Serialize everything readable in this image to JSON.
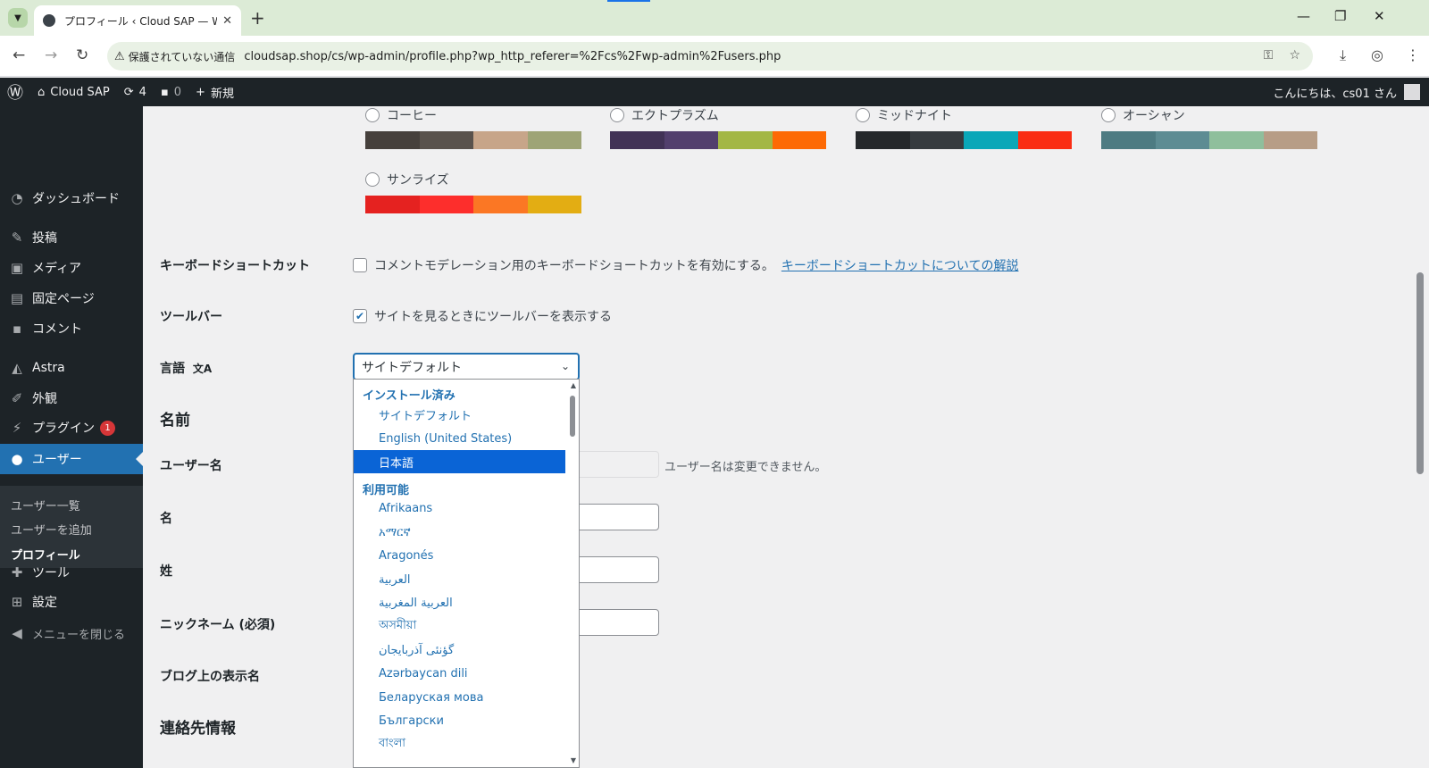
{
  "browser": {
    "tab_title": "プロフィール ‹ Cloud SAP — WordPress",
    "security_label": "保護されていない通信",
    "url": "cloudsap.shop/cs/wp-admin/profile.php?wp_http_referer=%2Fcs%2Fwp-admin%2Fusers.php"
  },
  "adminbar": {
    "site_name": "Cloud SAP",
    "updates_count": "4",
    "comments_count": "0",
    "new_label": "新規",
    "greeting": "こんにちは、cs01 さん"
  },
  "sidebar": {
    "items": [
      {
        "label": "ダッシュボード",
        "icon": "dashboard-icon"
      },
      {
        "label": "投稿",
        "icon": "pin-icon"
      },
      {
        "label": "メディア",
        "icon": "media-icon"
      },
      {
        "label": "固定ページ",
        "icon": "page-icon"
      },
      {
        "label": "コメント",
        "icon": "comment-icon"
      },
      {
        "label": "Astra",
        "icon": "astra-icon"
      },
      {
        "label": "外観",
        "icon": "brush-icon"
      },
      {
        "label": "プラグイン",
        "icon": "plugin-icon",
        "badge": "1"
      },
      {
        "label": "ユーザー",
        "icon": "user-icon"
      },
      {
        "label": "ツール",
        "icon": "wrench-icon"
      },
      {
        "label": "設定",
        "icon": "settings-icon"
      }
    ],
    "submenu": [
      "ユーザー一覧",
      "ユーザーを追加",
      "プロフィール"
    ],
    "collapse_label": "メニューを閉じる"
  },
  "color_schemes": [
    {
      "name": "コーヒー",
      "colors": [
        "#46403c",
        "#59524c",
        "#c7a589",
        "#9ea476"
      ]
    },
    {
      "name": "エクトプラズム",
      "colors": [
        "#413256",
        "#523f6d",
        "#a3b745",
        "#d46f15"
      ]
    },
    {
      "name": "ミッドナイト",
      "colors": [
        "#25282b",
        "#363b3f",
        "#69a8bb",
        "#e14d43"
      ]
    },
    {
      "name": "オーシャン",
      "colors": [
        "#627c83",
        "#738e96",
        "#9ebaa0",
        "#aa9d88"
      ]
    },
    {
      "name": "サンライズ",
      "colors": [
        "#b43c38",
        "#cf4944",
        "#dd823b",
        "#ccaf0b"
      ]
    }
  ],
  "form": {
    "shortcut_label": "キーボードショートカット",
    "shortcut_text": "コメントモデレーション用のキーボードショートカットを有効にする。",
    "shortcut_link": "キーボードショートカットについての解説",
    "toolbar_label": "ツールバー",
    "toolbar_text": "サイトを見るときにツールバーを表示する",
    "toolbar_checked": true,
    "language_label": "言語",
    "language_value": "サイトデフォルト",
    "name_section": "名前",
    "username_label": "ユーザー名",
    "username_desc": "ユーザー名は変更できません。",
    "first_name_label": "名",
    "last_name_label": "姓",
    "nickname_label": "ニックネーム (必須)",
    "display_name_label": "ブログ上の表示名",
    "contact_section": "連絡先情報"
  },
  "language_dropdown": {
    "installed_group": "インストール済み",
    "installed": [
      "サイトデフォルト",
      "English (United States)",
      "日本語"
    ],
    "selected": "日本語",
    "available_group": "利用可能",
    "available": [
      "Afrikaans",
      "አማርኛ",
      "Aragonés",
      "العربية",
      "العربية المغربية",
      "অসমীয়া",
      "گؤنئی آذربایجان",
      "Azərbaycan dili",
      "Беларуская мова",
      "Български",
      "বাংলা"
    ]
  }
}
